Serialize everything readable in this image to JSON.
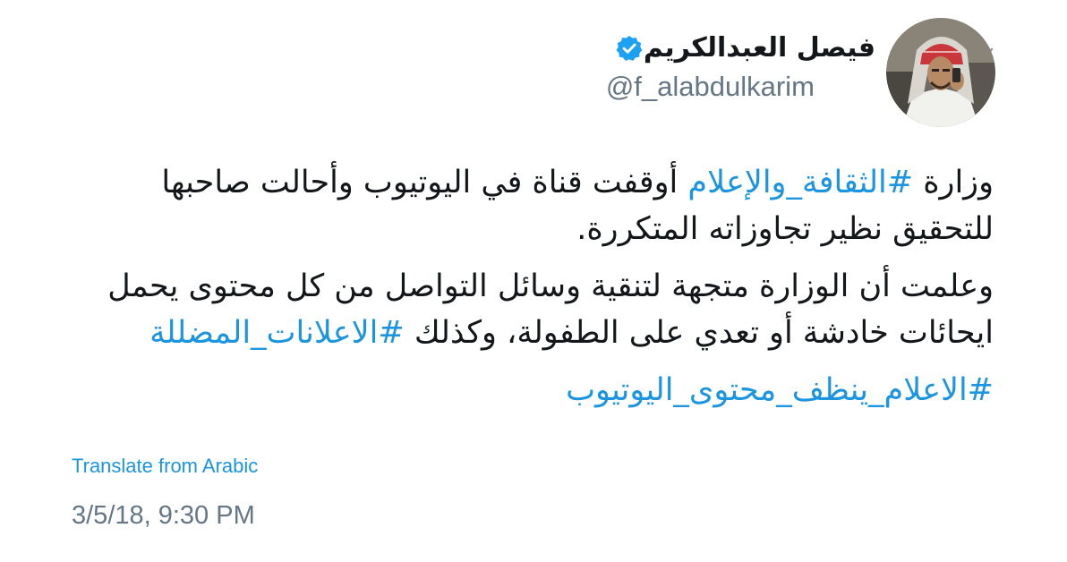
{
  "tweet": {
    "author": {
      "display_name": "فيصل العبدالكريم",
      "handle": "@f_alabdulkarim",
      "verified": true
    },
    "text": {
      "p1_prefix": "وزارة ",
      "p1_hashtag": "#الثقافة_والإعلام",
      "p1_rest": " أوقفت قناة في اليوتيوب وأحالت صاحبها للتحقيق نظير تجاوزاته المتكررة.",
      "p2_text": "وعلمت أن الوزارة متجهة لتنقية وسائل التواصل من كل محتوى يحمل ايحائات خادشة أو تعدي على الطفولة، وكذلك ",
      "p2_hashtag": "#الاعلانات_المضللة",
      "p3_hashtag": "#الاعلام_ينظف_محتوى_اليوتيوب"
    },
    "translate_label": "Translate from Arabic",
    "timestamp": "3/5/18, 9:30 PM"
  },
  "icons": {
    "chevron": "chevron-down-icon",
    "verified": "verified-badge-icon",
    "avatar": "avatar"
  },
  "colors": {
    "link": "#1b95e0",
    "text": "#14171a",
    "secondary": "#657786",
    "verified": "#1da1f2"
  }
}
